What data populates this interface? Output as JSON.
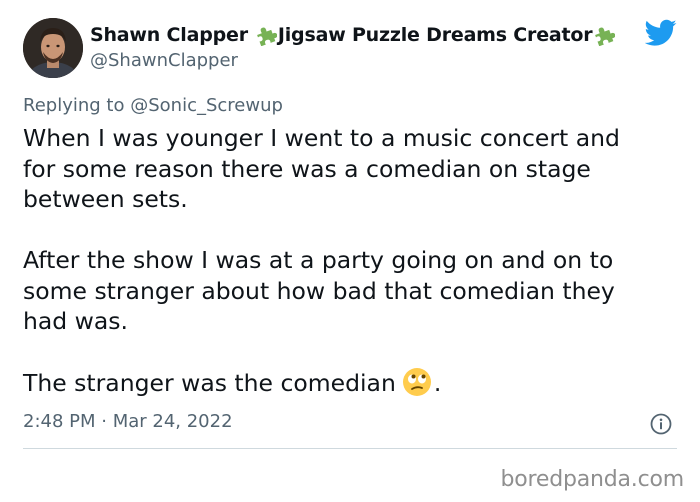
{
  "tweet": {
    "author": {
      "name_part1": "Shawn Clapper",
      "name_part2": "Jigsaw Puzzle Dreams Creator",
      "handle": "@ShawnClapper"
    },
    "replying_to": {
      "prefix": "Replying to",
      "mention": "@Sonic_Screwup"
    },
    "body": {
      "paragraph1_line1": "When I was younger I went to a music concert and",
      "paragraph1_line2": "for some reason there was a comedian on stage",
      "paragraph1_line3": "between sets.",
      "paragraph2_line1": "After the show I was at a party going on and on to",
      "paragraph2_line2": "some stranger about how bad that comedian they",
      "paragraph2_line3": "had was.",
      "paragraph3_text": "The stranger was the comedian",
      "paragraph3_end": ".",
      "emoji": "face-with-rolling-eyes"
    },
    "timestamp": "2:48 PM · Mar 24, 2022",
    "icons": {
      "puzzle": "puzzle-piece-icon",
      "brand": "twitter-bird-icon",
      "info": "info-icon"
    }
  },
  "watermark": "boredpanda.com",
  "colors": {
    "twitter_blue": "#1d9bf0",
    "secondary_text": "#536471",
    "primary_text": "#0f1419",
    "puzzle_green": "#77b255",
    "divider": "#cfd9de",
    "watermark": "#8f8f8f"
  }
}
